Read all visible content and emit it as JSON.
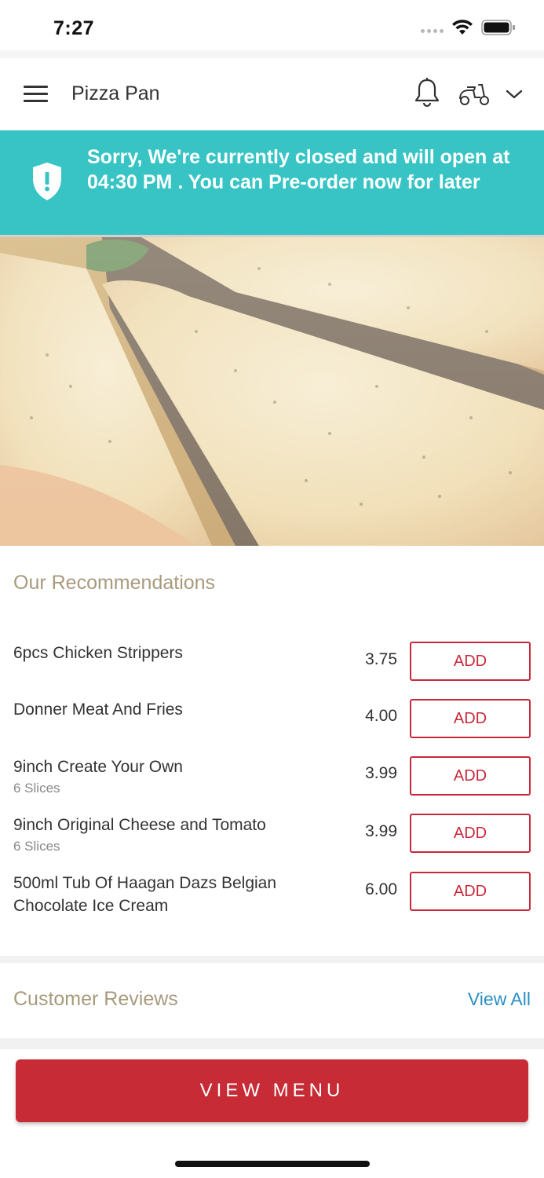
{
  "status_bar": {
    "time": "7:27"
  },
  "header": {
    "title": "Pizza Pan"
  },
  "banner": {
    "message": "Sorry, We're currently closed and will open at 04:30 PM . You can Pre-order now for later",
    "color": "#38c4c4"
  },
  "recommendations": {
    "title": "Our Recommendations",
    "items": [
      {
        "name": "6pcs Chicken Strippers",
        "subtitle": "",
        "price": "3.75",
        "button": "ADD"
      },
      {
        "name": "Donner Meat And Fries",
        "subtitle": "",
        "price": "4.00",
        "button": "ADD"
      },
      {
        "name": "9inch Create Your Own",
        "subtitle": "6 Slices",
        "price": "3.99",
        "button": "ADD"
      },
      {
        "name": "9inch Original Cheese and Tomato",
        "subtitle": "6 Slices",
        "price": "3.99",
        "button": "ADD"
      },
      {
        "name": "500ml Tub Of Haagan Dazs Belgian Chocolate Ice Cream",
        "subtitle": "",
        "price": "6.00",
        "button": "ADD"
      }
    ]
  },
  "reviews": {
    "title": "Customer Reviews",
    "view_all": "View All"
  },
  "footer": {
    "view_menu": "VIEW MENU"
  },
  "colors": {
    "accent": "#c72b35",
    "banner": "#38c4c4",
    "section_title": "#a89a7c",
    "link": "#2a8fc5"
  },
  "icons": [
    "hamburger-menu-icon",
    "bell-icon",
    "scooter-icon",
    "chevron-down-icon",
    "shield-alert-icon",
    "wifi-icon",
    "battery-icon"
  ]
}
